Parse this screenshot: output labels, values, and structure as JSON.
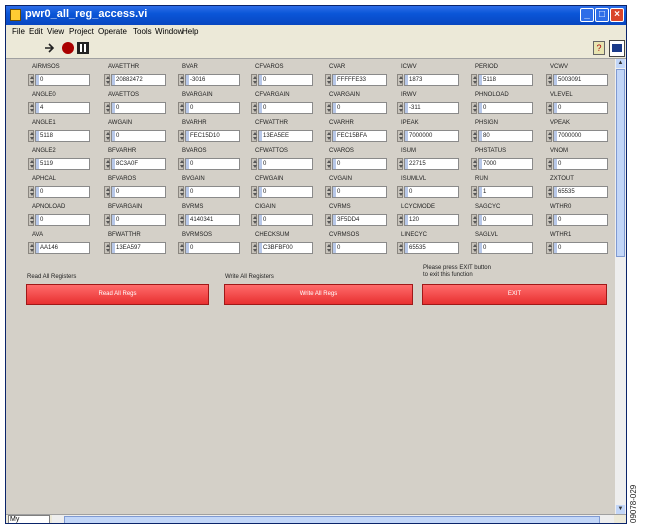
{
  "window": {
    "title": "pwr0_all_reg_access.vi"
  },
  "menu": [
    "File",
    "Edit",
    "View",
    "Project",
    "Operate",
    "Tools",
    "Window",
    "Help"
  ],
  "columns": [
    [
      {
        "label": "AIRMSOS",
        "value": "0"
      },
      {
        "label": "ANGLE0",
        "value": "4"
      },
      {
        "label": "ANGLE1",
        "value": "5118"
      },
      {
        "label": "ANGLE2",
        "value": "5119"
      },
      {
        "label": "APHCAL",
        "value": "0"
      },
      {
        "label": "APNOLOAD",
        "value": "0"
      },
      {
        "label": "AVA",
        "value": "AA146"
      }
    ],
    [
      {
        "label": "AVAETTHR",
        "value": "20882472"
      },
      {
        "label": "AVAETTOS",
        "value": "0"
      },
      {
        "label": "AWGAIN",
        "value": "0"
      },
      {
        "label": "BFVARHR",
        "value": "8C3A0F"
      },
      {
        "label": "BFVAROS",
        "value": "0"
      },
      {
        "label": "BFVARGAIN",
        "value": "0"
      },
      {
        "label": "BFWATTHR",
        "value": "13EA597"
      }
    ],
    [
      {
        "label": "BVAR",
        "value": "-3016"
      },
      {
        "label": "BVARGAIN",
        "value": "0"
      },
      {
        "label": "BVARHR",
        "value": "FEC15D10"
      },
      {
        "label": "BVAROS",
        "value": "0"
      },
      {
        "label": "BVGAIN",
        "value": "0"
      },
      {
        "label": "BVRMS",
        "value": "4140341"
      },
      {
        "label": "BVRMSOS",
        "value": "0"
      }
    ],
    [
      {
        "label": "CFVAROS",
        "value": "0"
      },
      {
        "label": "CFVARGAIN",
        "value": "0"
      },
      {
        "label": "CFWATTHR",
        "value": "13EA5EE"
      },
      {
        "label": "CFWATTOS",
        "value": "0"
      },
      {
        "label": "CFWGAIN",
        "value": "0"
      },
      {
        "label": "CIGAIN",
        "value": "0"
      },
      {
        "label": "CHECKSUM",
        "value": "C3BFBF00"
      }
    ],
    [
      {
        "label": "CVAR",
        "value": "FFFFFE33"
      },
      {
        "label": "CVARGAIN",
        "value": "0"
      },
      {
        "label": "CVARHR",
        "value": "FEC15BFA"
      },
      {
        "label": "CVAROS",
        "value": "0"
      },
      {
        "label": "CVGAIN",
        "value": "0"
      },
      {
        "label": "CVRMS",
        "value": "3F5DD4"
      },
      {
        "label": "CVRMSOS",
        "value": "0"
      }
    ],
    [
      {
        "label": "ICWV",
        "value": "1873"
      },
      {
        "label": "IRWV",
        "value": "-311"
      },
      {
        "label": "IPEAK",
        "value": "7000000"
      },
      {
        "label": "ISUM",
        "value": "22715"
      },
      {
        "label": "ISUMLVL",
        "value": "0"
      },
      {
        "label": "LCYCMODE",
        "value": "120"
      },
      {
        "label": "LINECYC",
        "value": "65535"
      }
    ],
    [
      {
        "label": "PERIOD",
        "value": "5118"
      },
      {
        "label": "PHNOLOAD",
        "value": "0"
      },
      {
        "label": "PHSIGN",
        "value": "80"
      },
      {
        "label": "PHSTATUS",
        "value": "7000"
      },
      {
        "label": "RUN",
        "value": "1"
      },
      {
        "label": "SAGCYC",
        "value": "0"
      },
      {
        "label": "SAGLVL",
        "value": "0"
      }
    ],
    [
      {
        "label": "VCWV",
        "value": "5003091"
      },
      {
        "label": "VLEVEL",
        "value": "0"
      },
      {
        "label": "VPEAK",
        "value": "7000000"
      },
      {
        "label": "VNOM",
        "value": "0"
      },
      {
        "label": "ZXTOUT",
        "value": "65535"
      },
      {
        "label": "WTHR0",
        "value": "0"
      },
      {
        "label": "WTHR1",
        "value": "0"
      }
    ]
  ],
  "actions": {
    "read_section": "Read All Registers",
    "read_button": "Read All Regs",
    "write_section": "Write All Registers",
    "write_button": "Write All Regs",
    "exit_note_1": "Please press EXIT button",
    "exit_note_2": "to exit this function",
    "exit_button": "EXIT"
  },
  "status": {
    "location": "My Computer"
  },
  "figure_id": "09078-029"
}
